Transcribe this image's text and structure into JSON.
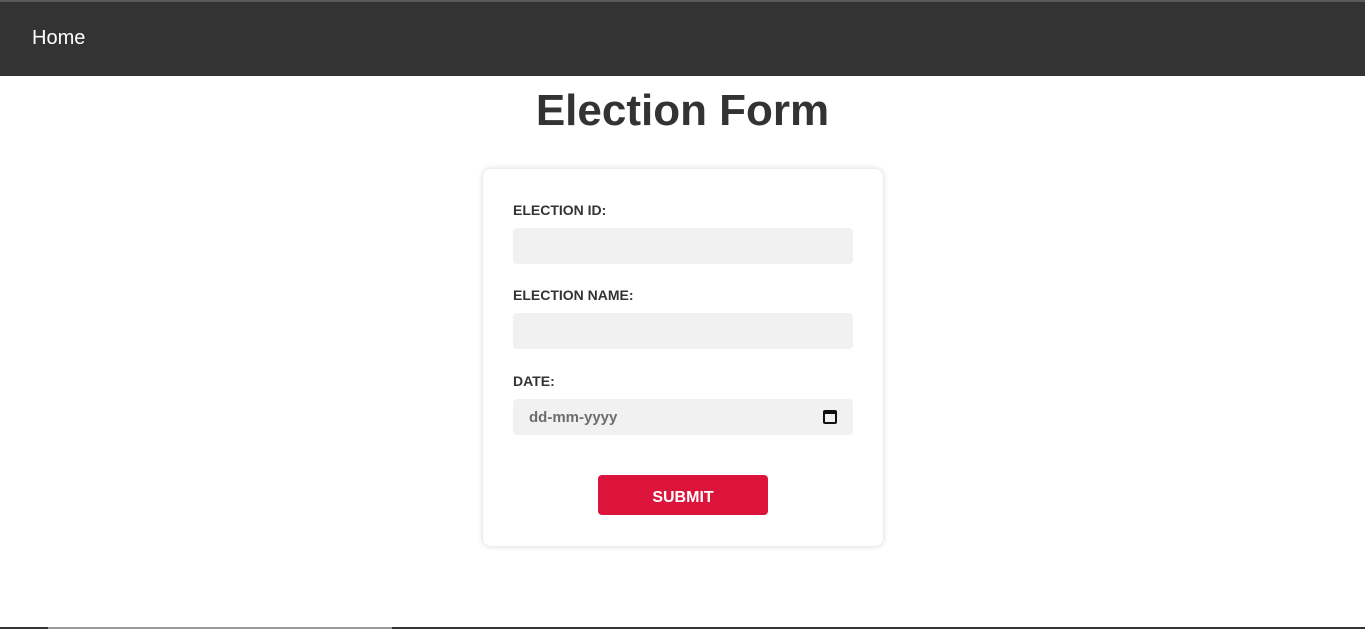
{
  "nav": {
    "home_label": "Home"
  },
  "page": {
    "title": "Election Form"
  },
  "form": {
    "election_id": {
      "label": "ELECTION ID:",
      "value": ""
    },
    "election_name": {
      "label": "ELECTION NAME:",
      "value": ""
    },
    "date": {
      "label": "DATE:",
      "placeholder": "dd-mm-yyyy",
      "icon": "calendar-icon"
    },
    "submit_label": "SUBMIT"
  },
  "colors": {
    "navbar": "#333333",
    "accent": "#dc143c",
    "input_bg": "#f1f1f1"
  }
}
